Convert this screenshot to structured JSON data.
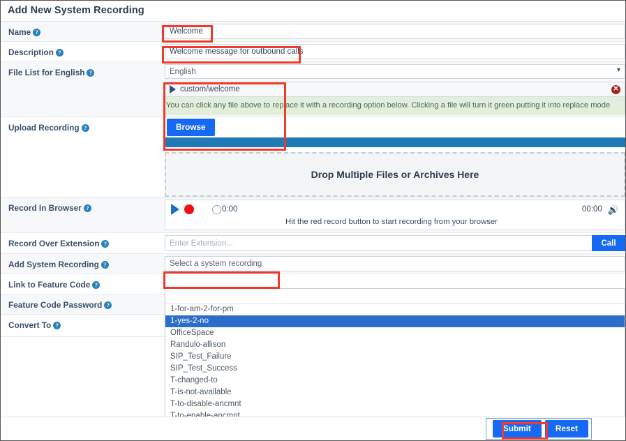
{
  "panel": {
    "title": "Add New System Recording"
  },
  "help_glyph": "?",
  "fields": {
    "name": {
      "label": "Name",
      "value": "Welcome",
      "placeholder": ""
    },
    "description": {
      "label": "Description",
      "value": "Welcome message for outbound calls",
      "placeholder": ""
    },
    "file_list": {
      "label": "File List for English",
      "selected_language": "English",
      "language_options": [
        "English"
      ],
      "chevron": "⌄",
      "files": [
        {
          "name": "custom/welcome",
          "play_icon": "play-icon",
          "delete_icon": "delete-icon",
          "delete_glyph": "✕"
        }
      ],
      "hint": "You can click any file above to replace it with a recording option below. Clicking a file will turn it green putting it into replace mode"
    },
    "upload_recording": {
      "label": "Upload Recording",
      "browse_label": "Browse",
      "progress_percent": 100,
      "dropzone_text": "Drop Multiple Files or Archives Here"
    },
    "record_in_browser": {
      "label": "Record In Browser",
      "play_icon": "play-icon",
      "record_icon": "record-icon",
      "current_time": "0:00",
      "total_time": "00:00",
      "volume_icon": "volume-icon",
      "volume_glyph": "🔊",
      "hint": "Hit the red record button to start recording from your browser"
    },
    "record_over_extension": {
      "label": "Record Over Extension",
      "placeholder": "Enter Extension...",
      "value": "",
      "call_label": "Call"
    },
    "add_system_recording": {
      "label": "Add System Recording",
      "placeholder": "Select a system recording",
      "value": "",
      "search_value": "",
      "options": [
        "1-for-am-2-for-pm",
        "1-yes-2-no",
        "OfficeSpace",
        "Randulo-allison",
        "SIP_Test_Failure",
        "SIP_Test_Success",
        "T-changed-to",
        "T-is-not-available",
        "T-to-disable-ancmnt",
        "T-to-enable-ancmnt"
      ],
      "highlighted_option": "1-yes-2-no"
    },
    "link_to_feature_code": {
      "label": "Link to Feature Code"
    },
    "feature_code_password": {
      "label": "Feature Code Password"
    },
    "convert_to": {
      "label": "Convert To"
    }
  },
  "footer": {
    "submit_label": "Submit",
    "reset_label": "Reset"
  },
  "colors": {
    "accent_blue": "#1569f5",
    "progress_blue": "#1f7ab5",
    "highlight_red": "#ef3b2d",
    "hint_green_bg": "#e2efdb",
    "record_red": "#f01010",
    "selected_option_blue": "#2b6ec9"
  }
}
